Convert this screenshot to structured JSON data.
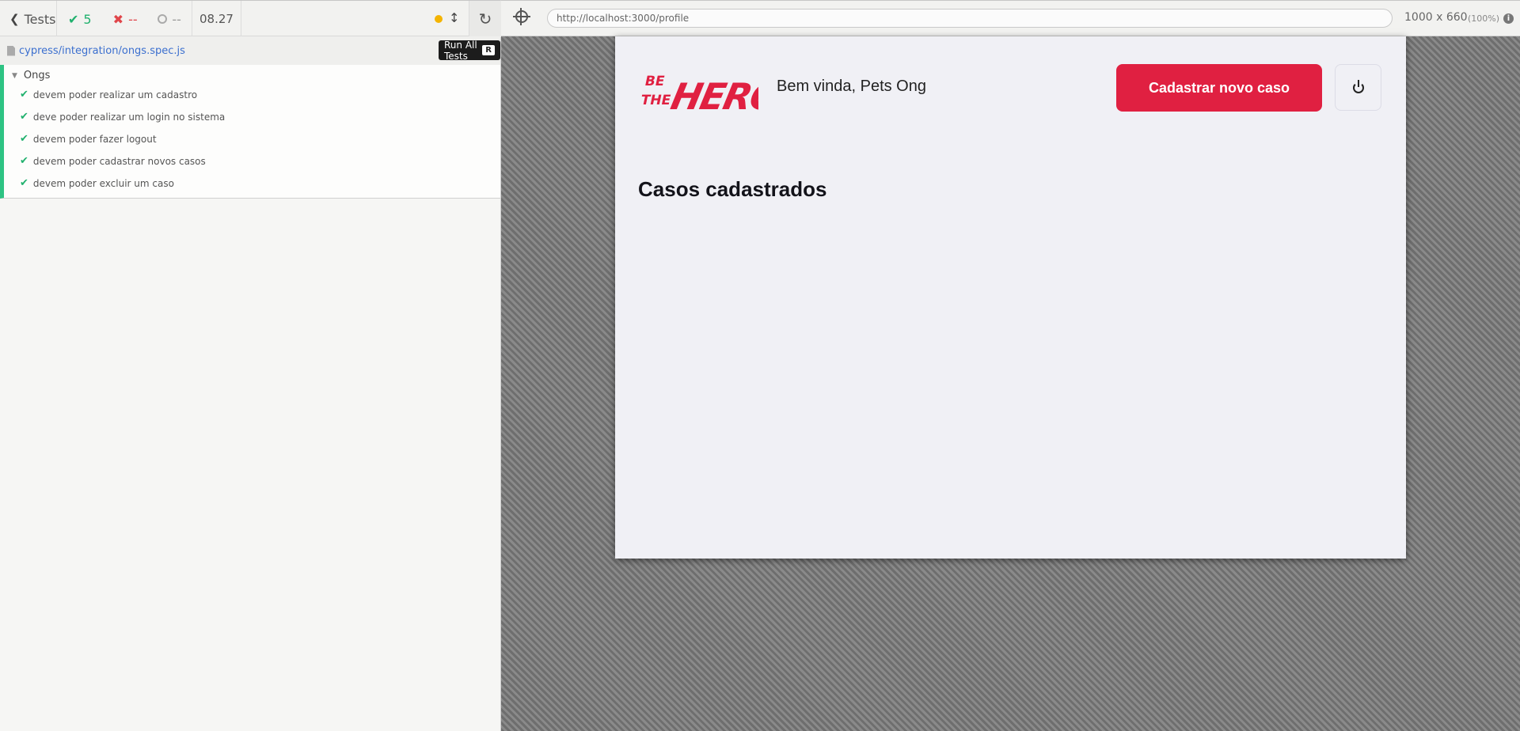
{
  "reporter": {
    "tests_label": "Tests",
    "stats": {
      "passed": "5",
      "failed": "--",
      "pending": "--"
    },
    "duration": "08.27",
    "tooltip": {
      "text": "Run All Tests",
      "key": "R"
    },
    "spec_file": "cypress/integration/ongs.spec.js",
    "suite": {
      "title": "Ongs",
      "tests": [
        "devem poder realizar um cadastro",
        "deve poder realizar um login no sistema",
        "devem poder fazer logout",
        "devem poder cadastrar novos casos",
        "devem poder excluir um caso"
      ]
    }
  },
  "aut": {
    "url": "http://localhost:3000/profile",
    "viewport_size": "1000 x 660",
    "viewport_scale": "(100%)"
  },
  "app": {
    "logo": {
      "line1": "BE",
      "line2": "THE",
      "word": "HERO"
    },
    "welcome": "Bem vinda, Pets Ong",
    "new_case_button": "Cadastrar novo caso",
    "cases_title": "Casos cadastrados"
  },
  "colors": {
    "pass": "#21b16e",
    "fail": "#e0454a",
    "brand": "#e02041",
    "link": "#3b6fcf"
  }
}
